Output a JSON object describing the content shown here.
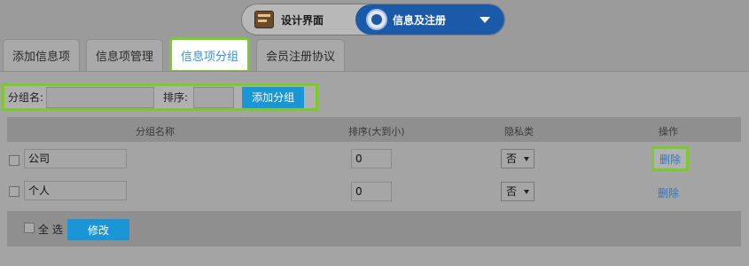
{
  "toggle": {
    "design_label": "设计界面",
    "info_label": "信息及注册"
  },
  "tabs": [
    {
      "label": "添加信息项",
      "active": false
    },
    {
      "label": "信息项管理",
      "active": false
    },
    {
      "label": "信息项分组",
      "active": true
    },
    {
      "label": "会员注册协议",
      "active": false
    }
  ],
  "add_group": {
    "name_label": "分组名:",
    "name_value": "",
    "order_label": "排序:",
    "order_value": "",
    "add_button": "添加分组"
  },
  "table": {
    "columns": [
      "分组名称",
      "排序(大到小)",
      "隐私类",
      "操作"
    ],
    "rows": [
      {
        "name": "公司",
        "order": "0",
        "privacy": "否",
        "action": "删除"
      },
      {
        "name": "个人",
        "order": "0",
        "privacy": "否",
        "action": "删除"
      }
    ]
  },
  "footer": {
    "select_all_label": "全 选",
    "modify_button": "修改"
  },
  "colors": {
    "highlight": "#7bc92b",
    "primary": "#1a5aa8",
    "button": "#1a95d6",
    "link": "#2a78c6"
  }
}
